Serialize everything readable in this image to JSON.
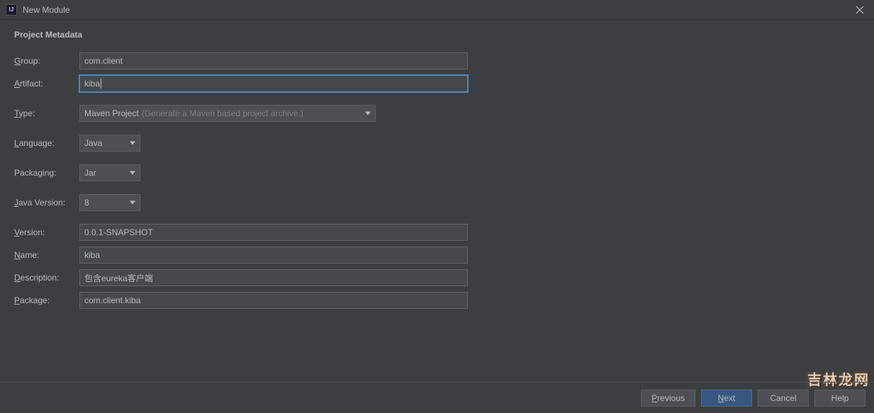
{
  "window": {
    "title": "New Module",
    "icon_label": "IJ"
  },
  "section_title": "Project Metadata",
  "labels": {
    "group": "roup:",
    "artifact": "rtifact:",
    "type": "ype:",
    "language": "anguage:",
    "packaging": "Packaging:",
    "java_version": "ava Version:",
    "version": "ersion:",
    "name": "ame:",
    "description": "escription:",
    "package": "ackage:"
  },
  "underlines": {
    "group": "G",
    "artifact": "A",
    "type": "T",
    "language": "L",
    "java_version": "J",
    "version": "V",
    "name": "N",
    "description": "D",
    "package": "P"
  },
  "fields": {
    "group": "com.client",
    "artifact": "kiba",
    "type_value": "Maven Project",
    "type_hint": "(Generate a Maven based project archive.)",
    "language": "Java",
    "packaging": "Jar",
    "java_version": "8",
    "version": "0.0.1-SNAPSHOT",
    "name": "kiba",
    "description": "包含eureka客户端",
    "package": "com.client.kiba"
  },
  "buttons": {
    "previous": "revious",
    "previous_ul": "P",
    "next": "ext",
    "next_ul": "N",
    "cancel": "Cancel",
    "help": "Help"
  },
  "watermark": "吉林龙网"
}
